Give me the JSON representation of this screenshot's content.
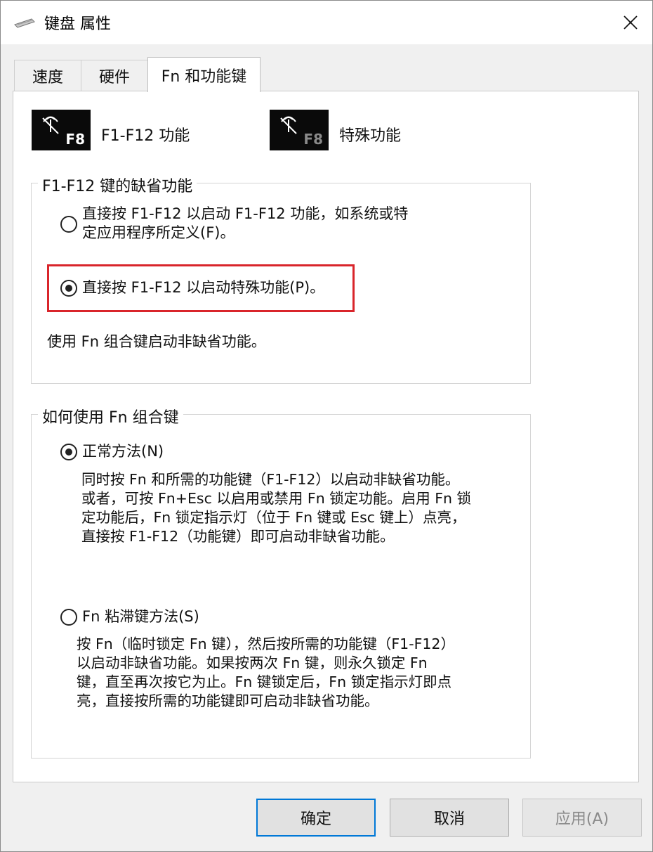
{
  "window": {
    "title": "键盘 属性"
  },
  "tabs": [
    {
      "label": "速度",
      "active": false
    },
    {
      "label": "硬件",
      "active": false
    },
    {
      "label": "Fn 和功能键",
      "active": true
    }
  ],
  "keys": [
    {
      "key": "F8",
      "caption": "F1-F12 功能",
      "key_color": "#ffffff"
    },
    {
      "key": "F8",
      "caption": "特殊功能",
      "key_color": "#8a8a8a"
    }
  ],
  "group_default": {
    "label": "F1-F12 键的缺省功能",
    "option1_line1": "直接按 F1-F12 以启动 F1-F12 功能，如系统或特",
    "option1_line2": "定应用程序所定义(F)。",
    "option2": "直接按 F1-F12 以启动特殊功能(P)。",
    "note": "使用 Fn 组合键启动非缺省功能。",
    "selected": "option2"
  },
  "group_fn": {
    "label": "如何使用 Fn 组合键",
    "normal_label": "正常方法(N)",
    "normal_desc": [
      "同时按 Fn 和所需的功能键（F1-F12）以启动非缺省功能。",
      "或者，可按 Fn+Esc 以启用或禁用 Fn 锁定功能。启用 Fn 锁",
      "定功能后，Fn 锁定指示灯（位于 Fn 键或 Esc 键上）点亮，",
      "直接按 F1-F12（功能键）即可启动非缺省功能。"
    ],
    "sticky_label": "Fn 粘滞键方法(S)",
    "sticky_desc": [
      "按 Fn（临时锁定 Fn 键），然后按所需的功能键（F1-F12）",
      "以启动非缺省功能。如果按两次 Fn 键，则永久锁定 Fn",
      "键，直至再次按它为止。Fn 键锁定后，Fn 锁定指示灯即点",
      "亮，直接按所需的功能键即可启动非缺省功能。"
    ],
    "selected": "normal"
  },
  "buttons": {
    "ok": "确定",
    "cancel": "取消",
    "apply": "应用(A)"
  },
  "colors": {
    "highlight": "#d9252b",
    "primary_border": "#0078d7"
  }
}
